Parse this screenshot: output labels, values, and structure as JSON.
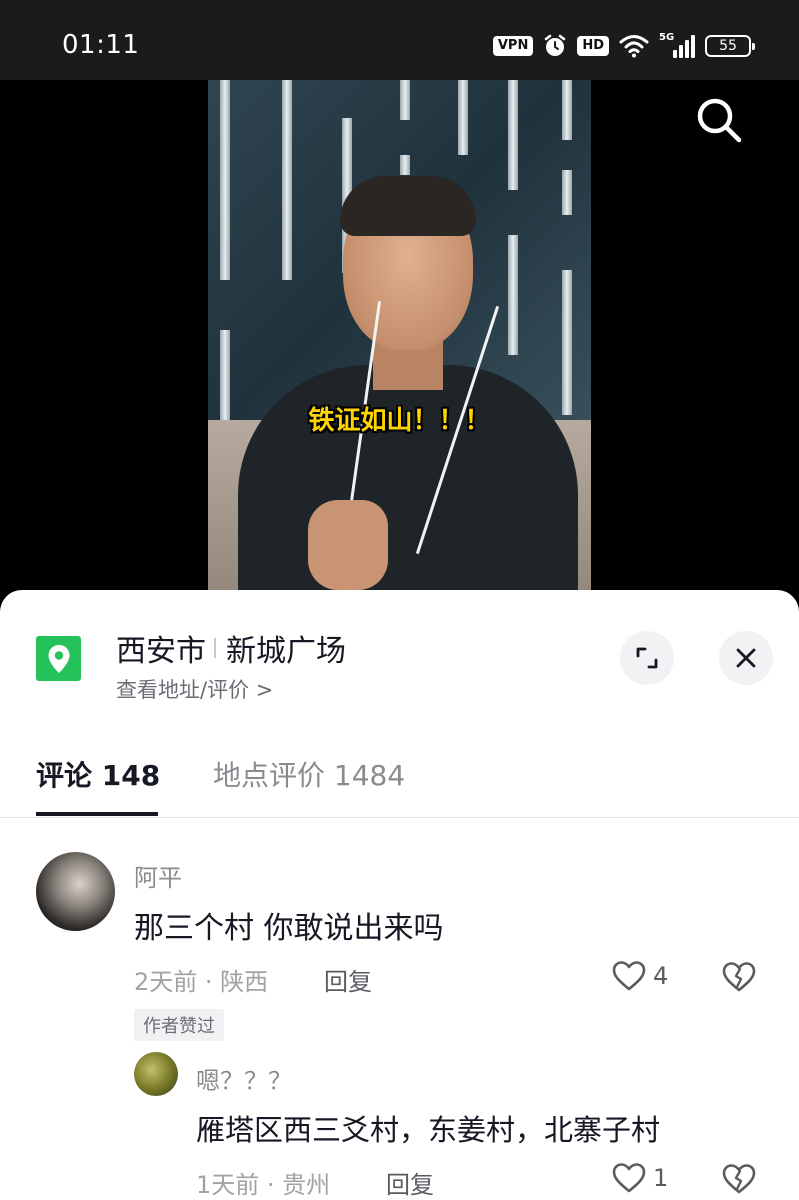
{
  "status_bar": {
    "time": "01:11",
    "vpn_label": "VPN",
    "hd_label": "HD",
    "network_label": "5G",
    "battery_level": "55",
    "icons": [
      "alarm-icon",
      "wifi-icon",
      "signal-icon",
      "battery-icon"
    ]
  },
  "video": {
    "subtitle": "铁证如山！！！",
    "subtitle_color": "#ffd400",
    "search_icon": "search-icon"
  },
  "location": {
    "city": "西安市",
    "place": "新城广场",
    "link": "查看地址/评价 >",
    "pin_color": "#25c25c",
    "expand_icon": "expand-icon",
    "close_icon": "close-icon"
  },
  "tabs": [
    {
      "label": "评论 148",
      "active": true
    },
    {
      "label": "地点评价 1484",
      "active": false
    }
  ],
  "comments": [
    {
      "username": "阿平",
      "text": "那三个村   你敢说出来吗",
      "meta": "2天前 · 陕西",
      "reply_label": "回复",
      "likes": "4",
      "badge": "作者赞过"
    },
    {
      "username": "嗯？？？",
      "text": "雁塔区西三爻村，东姜村，北寨子村",
      "meta": "1天前 · 贵州",
      "reply_label": "回复",
      "likes": "1"
    }
  ]
}
